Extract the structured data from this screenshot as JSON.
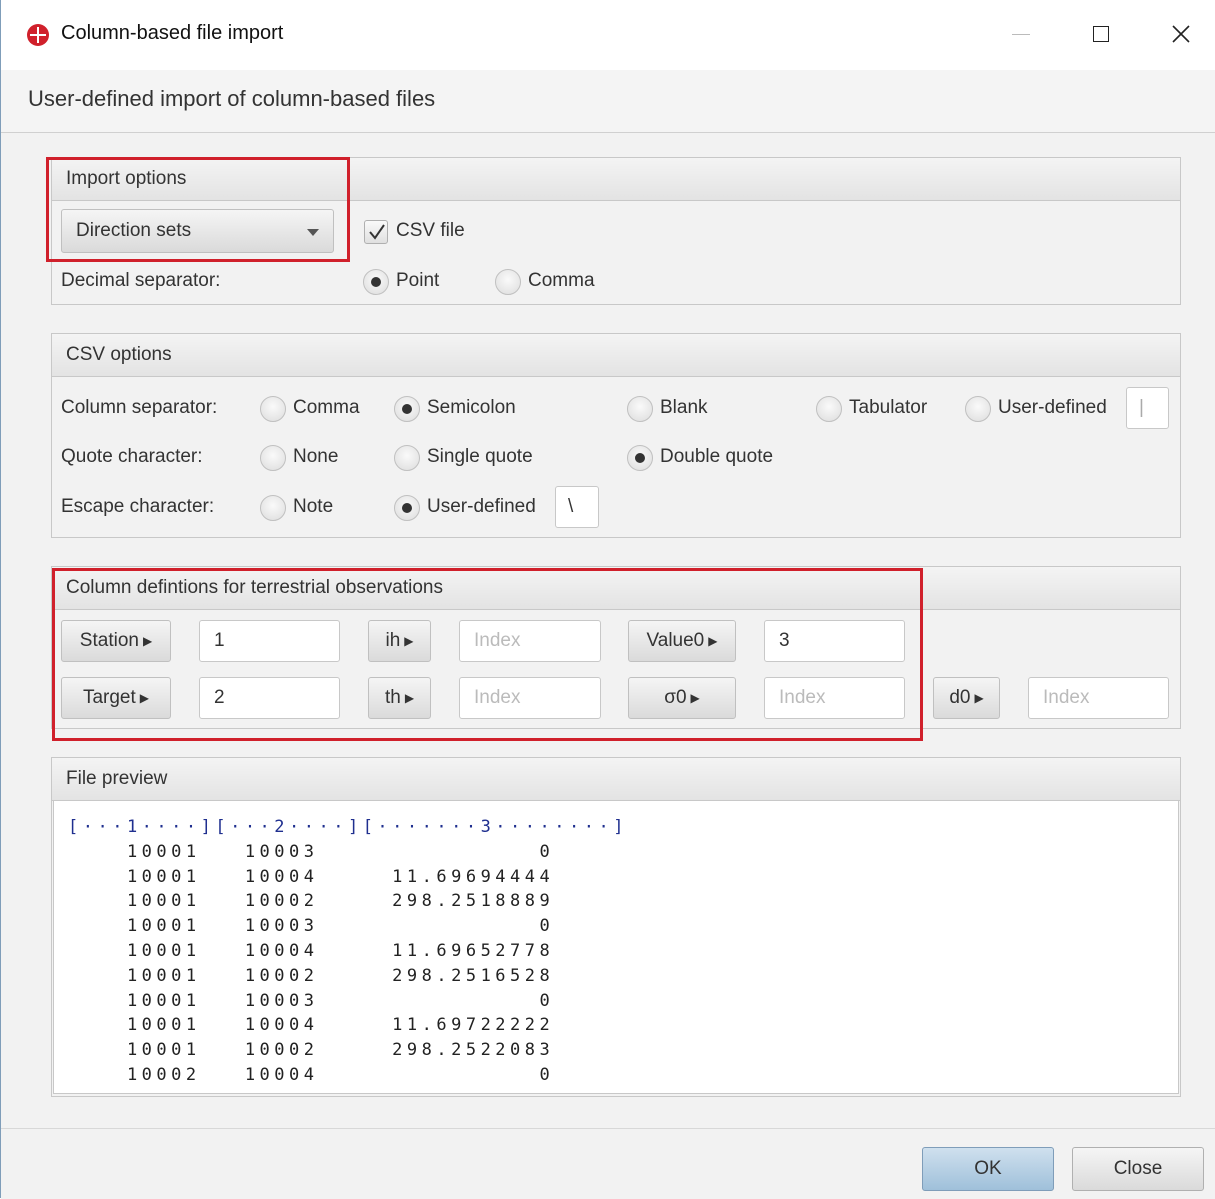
{
  "window": {
    "title": "Column-based file import",
    "header": "User-defined import of column-based files"
  },
  "import_options": {
    "title": "Import options",
    "type_selected": "Direction sets",
    "csv_file_label": "CSV file",
    "csv_file_checked": true,
    "decimal_label": "Decimal separator:",
    "decimal_options": [
      "Point",
      "Comma"
    ],
    "decimal_selected": "Point"
  },
  "csv_options": {
    "title": "CSV options",
    "column_separator": {
      "label": "Column separator:",
      "options": [
        "Comma",
        "Semicolon",
        "Blank",
        "Tabulator",
        "User-defined"
      ],
      "selected": "Semicolon",
      "user_value": "|"
    },
    "quote_character": {
      "label": "Quote character:",
      "options": [
        "None",
        "Single quote",
        "Double quote"
      ],
      "selected": "Double quote"
    },
    "escape_character": {
      "label": "Escape character:",
      "options": [
        "Note",
        "User-defined"
      ],
      "selected": "User-defined",
      "user_value": "\\"
    }
  },
  "column_defs": {
    "title": "Column defintions for terrestrial observations",
    "buttons": {
      "station": "Station",
      "target": "Target",
      "ih": "ih",
      "th": "th",
      "value0": "Value0",
      "sigma0": "σ0",
      "d0": "d0"
    },
    "values": {
      "station": "1",
      "target": "2",
      "value0": "3"
    },
    "placeholder": "Index"
  },
  "preview": {
    "title": "File preview",
    "ruler": "[···1····][···2····][·······3········]",
    "rows": [
      [
        "10001",
        "10003",
        "0"
      ],
      [
        "10001",
        "10004",
        "11.69694444"
      ],
      [
        "10001",
        "10002",
        "298.2518889"
      ],
      [
        "10001",
        "10003",
        "0"
      ],
      [
        "10001",
        "10004",
        "11.69652778"
      ],
      [
        "10001",
        "10002",
        "298.2516528"
      ],
      [
        "10001",
        "10003",
        "0"
      ],
      [
        "10001",
        "10004",
        "11.69722222"
      ],
      [
        "10001",
        "10002",
        "298.2522083"
      ],
      [
        "10002",
        "10004",
        "0"
      ]
    ]
  },
  "footer": {
    "ok": "OK",
    "close": "Close"
  },
  "colors": {
    "highlight": "#d0202b",
    "ruler": "#1f2f8f",
    "ok_button": "#9fc0da"
  }
}
